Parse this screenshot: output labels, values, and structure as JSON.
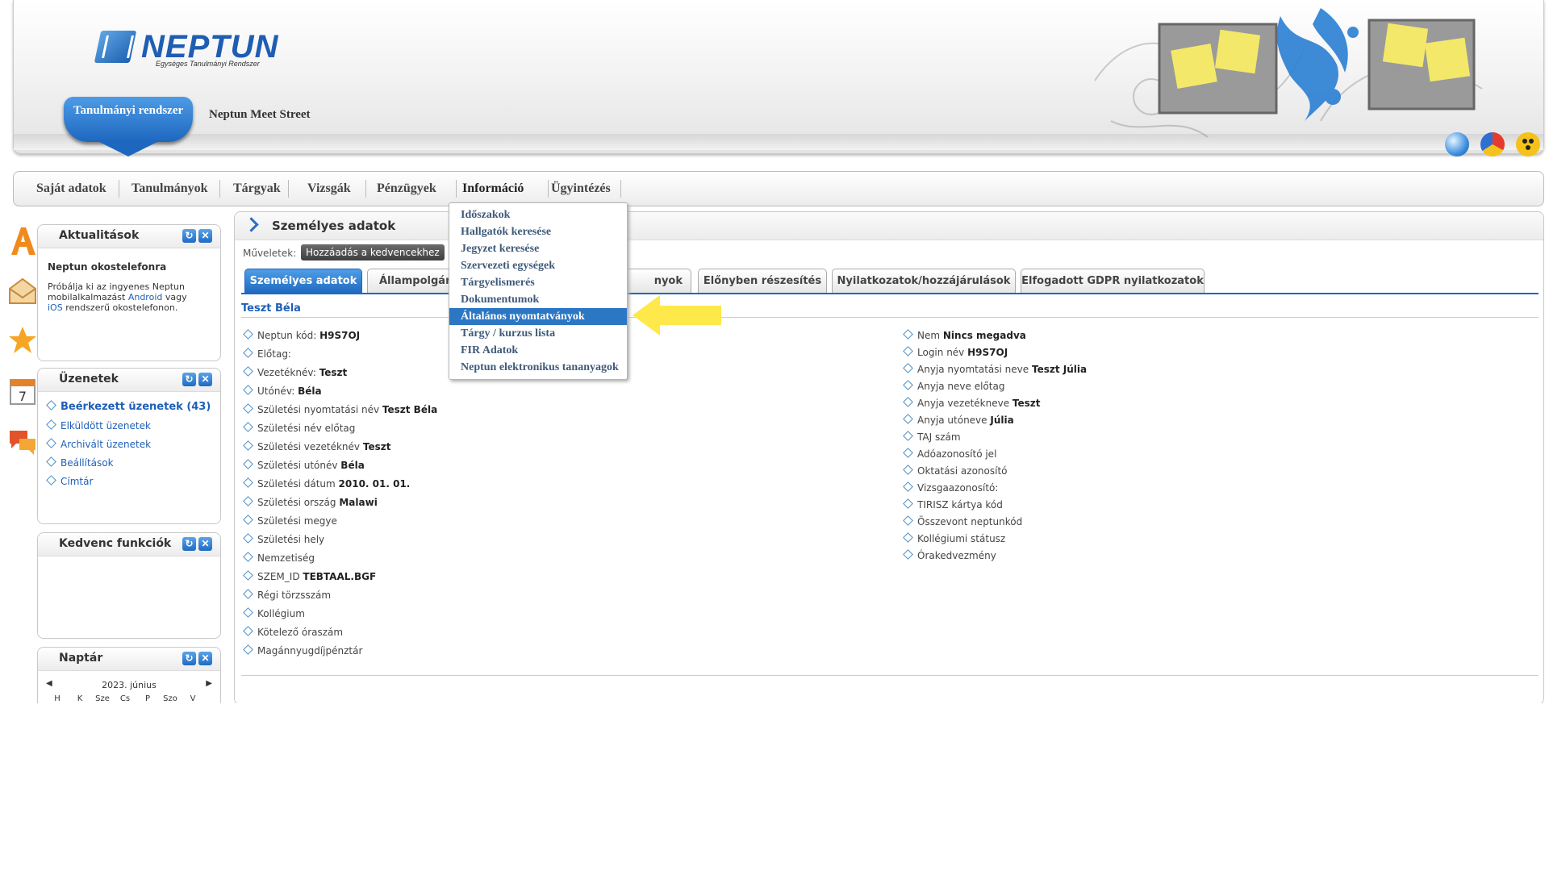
{
  "header": {
    "logo_text": "NEPTUN",
    "logo_subtitle": "Egységes Tanulmányi Rendszer",
    "system_tab": "Tanulmányi rendszer",
    "meet_street": "Neptun Meet Street"
  },
  "nav": {
    "items": [
      "Saját adatok",
      "Tanulmányok",
      "Tárgyak",
      "Vizsgák",
      "Pénzügyek",
      "Információ",
      "Ügyintézés"
    ],
    "active": "Információ"
  },
  "dropdown": {
    "items": [
      "Időszakok",
      "Hallgatók keresése",
      "Jegyzet keresése",
      "Szervezeti egységek",
      "Tárgyelismerés",
      "Dokumentumok",
      "Általános nyomtatványok",
      "Tárgy / kurzus lista",
      "FIR Adatok",
      "Neptun elektronikus tananyagok"
    ],
    "highlighted": "Általános nyomtatványok"
  },
  "widgets": {
    "news": {
      "title": "Aktualitások",
      "headline": "Neptun okostelefonra",
      "text_1": "Próbálja ki az ingyenes Neptun",
      "text_2a": "mobilalkalmazást",
      "text_2b": "Android",
      "text_2c": "vagy",
      "text_3a": "iOS",
      "text_3b": "rendszerű okostelefonon."
    },
    "messages": {
      "title": "Üzenetek",
      "items": [
        "Beérkezett üzenetek (43)",
        "Elküldött üzenetek",
        "Archivált üzenetek",
        "Beállítások",
        "Címtár"
      ]
    },
    "favorites": {
      "title": "Kedvenc funkciók"
    },
    "calendar": {
      "title": "Naptár",
      "month": "2023. június",
      "days": [
        "H",
        "K",
        "Sze",
        "Cs",
        "P",
        "Szo",
        "V"
      ]
    }
  },
  "main": {
    "title": "Személyes adatok",
    "ops_label": "Műveletek:",
    "ops_button": "Hozzáadás a kedvencekhez",
    "tabs": [
      "Személyes adatok",
      "Állampolgárs",
      "nyok",
      "Előnyben részesítés",
      "Nyilatkozatok/hozzájárulások",
      "Elfogadott GDPR nyilatkozatok"
    ],
    "person_name": "Teszt Béla",
    "left_fields": [
      {
        "label": "Neptun kód:",
        "value": "H9S7OJ"
      },
      {
        "label": "Előtag:",
        "value": ""
      },
      {
        "label": "Vezetéknév:",
        "value": "Teszt"
      },
      {
        "label": "Utónév:",
        "value": "Béla"
      },
      {
        "label": "Születési nyomtatási név",
        "value": "Teszt Béla"
      },
      {
        "label": "Születési név előtag",
        "value": ""
      },
      {
        "label": "Születési vezetéknév",
        "value": "Teszt"
      },
      {
        "label": "Születési utónév",
        "value": "Béla"
      },
      {
        "label": "Születési dátum",
        "value": "2010. 01. 01."
      },
      {
        "label": "Születési ország",
        "value": "Malawi"
      },
      {
        "label": "Születési megye",
        "value": ""
      },
      {
        "label": "Születési hely",
        "value": ""
      },
      {
        "label": "Nemzetiség",
        "value": ""
      },
      {
        "label": "SZEM_ID",
        "value": "TEBTAAL.BGF"
      },
      {
        "label": "Régi törzsszám",
        "value": ""
      },
      {
        "label": "Kollégium",
        "value": ""
      },
      {
        "label": "Kötelező óraszám",
        "value": ""
      },
      {
        "label": "Magánnyugdíjpénztár",
        "value": ""
      }
    ],
    "right_fields": [
      {
        "label": "Nem",
        "value": "Nincs megadva"
      },
      {
        "label": "Login név",
        "value": "H9S7OJ"
      },
      {
        "label": "Anyja nyomtatási neve",
        "value": "Teszt Júlia"
      },
      {
        "label": "Anyja neve előtag",
        "value": ""
      },
      {
        "label": "Anyja vezetékneve",
        "value": "Teszt"
      },
      {
        "label": "Anyja utóneve",
        "value": "Júlia"
      },
      {
        "label": "TAJ szám",
        "value": ""
      },
      {
        "label": "Adóazonosító jel",
        "value": ""
      },
      {
        "label": "Oktatási azonosító",
        "value": ""
      },
      {
        "label": "Vizsgaazonosító:",
        "value": ""
      },
      {
        "label": "TIRISZ kártya kód",
        "value": ""
      },
      {
        "label": "Összevont neptunkód",
        "value": ""
      },
      {
        "label": "Kollégiumi státusz",
        "value": ""
      },
      {
        "label": "Órakedvezmény",
        "value": ""
      }
    ]
  },
  "colors": {
    "accent": "#1e68c0",
    "link": "#1e5fb8",
    "highlight": "#2c77c4",
    "arrow": "#ffe84a"
  }
}
